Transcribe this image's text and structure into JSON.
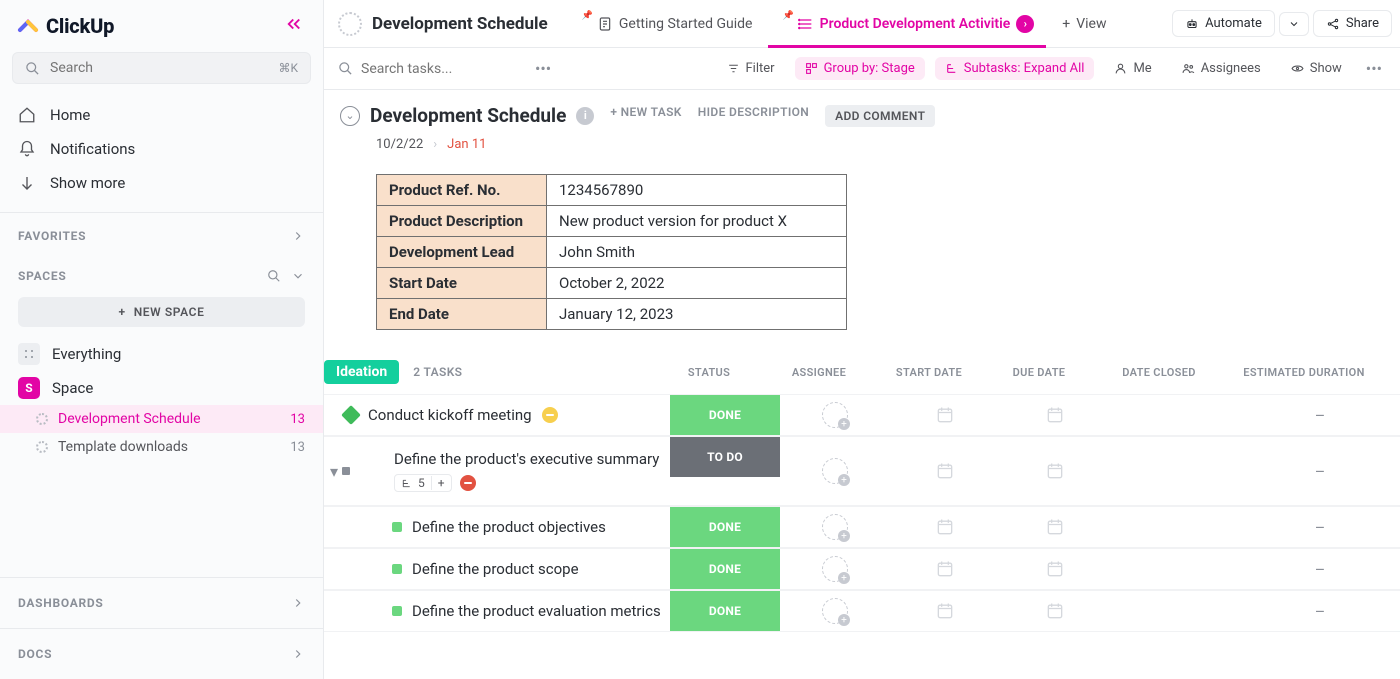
{
  "brand": "ClickUp",
  "search": {
    "placeholder": "Search",
    "shortcut": "⌘K"
  },
  "nav": {
    "home": "Home",
    "notifications": "Notifications",
    "show_more": "Show more"
  },
  "sections": {
    "favorites": "FAVORITES",
    "spaces": "SPACES",
    "dashboards": "DASHBOARDS",
    "docs": "DOCS"
  },
  "spaces": {
    "new_space": "NEW SPACE",
    "everything": "Everything",
    "space_name": "Space",
    "space_initial": "S",
    "lists": [
      {
        "name": "Development Schedule",
        "count": "13",
        "active": true
      },
      {
        "name": "Template downloads",
        "count": "13",
        "active": false
      }
    ]
  },
  "breadcrumb": {
    "title": "Development Schedule"
  },
  "tabs": {
    "guide": "Getting Started Guide",
    "activities": "Product Development Activitie",
    "view": "View"
  },
  "top_buttons": {
    "automate": "Automate",
    "share": "Share"
  },
  "toolbar": {
    "search_placeholder": "Search tasks...",
    "filter": "Filter",
    "group_by": "Group by: Stage",
    "subtasks": "Subtasks: Expand All",
    "me": "Me",
    "assignees": "Assignees",
    "show": "Show"
  },
  "doc": {
    "title": "Development Schedule",
    "new_task": "+ NEW TASK",
    "hide_desc": "HIDE DESCRIPTION",
    "add_comment": "ADD COMMENT",
    "date_created": "10/2/22",
    "date_due": "Jan 11"
  },
  "info_table": [
    {
      "label": "Product Ref. No.",
      "value": "1234567890"
    },
    {
      "label": "Product Description",
      "value": "New product version for product X"
    },
    {
      "label": "Development Lead",
      "value": "John Smith"
    },
    {
      "label": "Start Date",
      "value": "October 2, 2022"
    },
    {
      "label": "End Date",
      "value": "January 12, 2023"
    }
  ],
  "group": {
    "stage": "Ideation",
    "count": "2 TASKS",
    "columns": {
      "status": "STATUS",
      "assignee": "ASSIGNEE",
      "start": "START DATE",
      "due": "DUE DATE",
      "closed": "DATE CLOSED",
      "duration": "ESTIMATED DURATION"
    }
  },
  "tasks": [
    {
      "title": "Conduct kickoff meeting",
      "status": "DONE",
      "status_class": "done",
      "badge": "yellow",
      "duration": "–"
    },
    {
      "title": "Define the product's executive summary",
      "status": "TO DO",
      "status_class": "todo",
      "badge": "red",
      "subtask_count": "5",
      "duration": "–"
    },
    {
      "title": "Define the product objectives",
      "status": "DONE",
      "status_class": "done",
      "indent": 2,
      "duration": "–"
    },
    {
      "title": "Define the product scope",
      "status": "DONE",
      "status_class": "done",
      "indent": 2,
      "duration": "–"
    },
    {
      "title": "Define the product evaluation metrics",
      "status": "DONE",
      "status_class": "done",
      "indent": 2,
      "duration": "–"
    }
  ]
}
